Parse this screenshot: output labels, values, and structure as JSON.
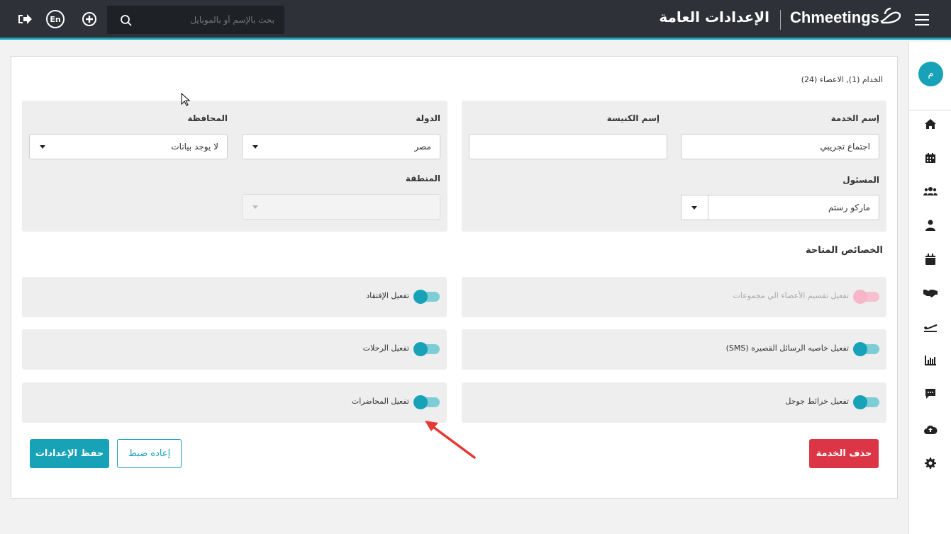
{
  "topbar": {
    "search_placeholder": "بحث بالإسم أو بالموبايل",
    "lang_label": "En",
    "page_title": "الإعدادات العامة",
    "brand": "Chmeetings"
  },
  "sidebar": {
    "avatar_initial": "م",
    "items": [
      "home-icon",
      "calendar-icon",
      "users-icon",
      "user-icon",
      "event-icon",
      "handshake-icon",
      "plane-icon",
      "chart-icon",
      "chat-icon",
      "cloud-upload-icon",
      "gear-icon"
    ]
  },
  "main": {
    "counts": "الخدام (1), الاعضاء (24)",
    "service_name_label": "إسم الخدمة",
    "service_name_value": "اجتماع تجريبي",
    "church_name_label": "إسم الكنيسة",
    "church_name_value": "",
    "manager_label": "المسئول",
    "manager_value": "ماركو رستم",
    "country_label": "الدولة",
    "country_value": "مصر",
    "governorate_label": "المحافظة",
    "governorate_value": "لا يوجد بيانات",
    "region_label": "المنطقة",
    "region_value": "",
    "features_title": "الخصائص المتاحة",
    "features": [
      {
        "label": "تفعيل تقسيم الأعضاء الي مجموعات",
        "enabled": false
      },
      {
        "label": "تفعيل الإفتقاد",
        "enabled": true
      },
      {
        "label": "تفعيل خاصيه الرسائل القصيره (SMS)",
        "enabled": true
      },
      {
        "label": "تفعيل الرحلات",
        "enabled": true
      },
      {
        "label": "تفعيل خرائط جوجل",
        "enabled": true
      },
      {
        "label": "تفعيل المحاضرات",
        "enabled": true
      }
    ],
    "delete_label": "حذف الخدمة",
    "reset_label": "إعاده ضبط",
    "save_label": "حفظ الإعدادات"
  },
  "colors": {
    "topbar": "#2e3238",
    "accent": "#17a2b8",
    "danger": "#dc3545"
  }
}
